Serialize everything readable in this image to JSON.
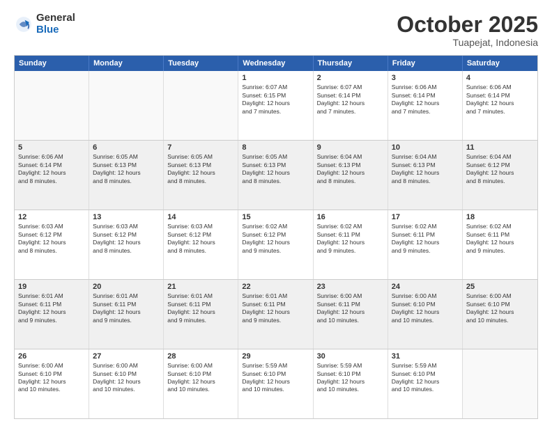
{
  "header": {
    "logo": {
      "general": "General",
      "blue": "Blue"
    },
    "title": "October 2025",
    "location": "Tuapejat, Indonesia"
  },
  "weekdays": [
    "Sunday",
    "Monday",
    "Tuesday",
    "Wednesday",
    "Thursday",
    "Friday",
    "Saturday"
  ],
  "rows": [
    [
      {
        "day": "",
        "text": "",
        "empty": true
      },
      {
        "day": "",
        "text": "",
        "empty": true
      },
      {
        "day": "",
        "text": "",
        "empty": true
      },
      {
        "day": "1",
        "text": "Sunrise: 6:07 AM\nSunset: 6:15 PM\nDaylight: 12 hours\nand 7 minutes."
      },
      {
        "day": "2",
        "text": "Sunrise: 6:07 AM\nSunset: 6:14 PM\nDaylight: 12 hours\nand 7 minutes."
      },
      {
        "day": "3",
        "text": "Sunrise: 6:06 AM\nSunset: 6:14 PM\nDaylight: 12 hours\nand 7 minutes."
      },
      {
        "day": "4",
        "text": "Sunrise: 6:06 AM\nSunset: 6:14 PM\nDaylight: 12 hours\nand 7 minutes."
      }
    ],
    [
      {
        "day": "5",
        "text": "Sunrise: 6:06 AM\nSunset: 6:14 PM\nDaylight: 12 hours\nand 8 minutes."
      },
      {
        "day": "6",
        "text": "Sunrise: 6:05 AM\nSunset: 6:13 PM\nDaylight: 12 hours\nand 8 minutes."
      },
      {
        "day": "7",
        "text": "Sunrise: 6:05 AM\nSunset: 6:13 PM\nDaylight: 12 hours\nand 8 minutes."
      },
      {
        "day": "8",
        "text": "Sunrise: 6:05 AM\nSunset: 6:13 PM\nDaylight: 12 hours\nand 8 minutes."
      },
      {
        "day": "9",
        "text": "Sunrise: 6:04 AM\nSunset: 6:13 PM\nDaylight: 12 hours\nand 8 minutes."
      },
      {
        "day": "10",
        "text": "Sunrise: 6:04 AM\nSunset: 6:13 PM\nDaylight: 12 hours\nand 8 minutes."
      },
      {
        "day": "11",
        "text": "Sunrise: 6:04 AM\nSunset: 6:12 PM\nDaylight: 12 hours\nand 8 minutes."
      }
    ],
    [
      {
        "day": "12",
        "text": "Sunrise: 6:03 AM\nSunset: 6:12 PM\nDaylight: 12 hours\nand 8 minutes."
      },
      {
        "day": "13",
        "text": "Sunrise: 6:03 AM\nSunset: 6:12 PM\nDaylight: 12 hours\nand 8 minutes."
      },
      {
        "day": "14",
        "text": "Sunrise: 6:03 AM\nSunset: 6:12 PM\nDaylight: 12 hours\nand 8 minutes."
      },
      {
        "day": "15",
        "text": "Sunrise: 6:02 AM\nSunset: 6:12 PM\nDaylight: 12 hours\nand 9 minutes."
      },
      {
        "day": "16",
        "text": "Sunrise: 6:02 AM\nSunset: 6:11 PM\nDaylight: 12 hours\nand 9 minutes."
      },
      {
        "day": "17",
        "text": "Sunrise: 6:02 AM\nSunset: 6:11 PM\nDaylight: 12 hours\nand 9 minutes."
      },
      {
        "day": "18",
        "text": "Sunrise: 6:02 AM\nSunset: 6:11 PM\nDaylight: 12 hours\nand 9 minutes."
      }
    ],
    [
      {
        "day": "19",
        "text": "Sunrise: 6:01 AM\nSunset: 6:11 PM\nDaylight: 12 hours\nand 9 minutes."
      },
      {
        "day": "20",
        "text": "Sunrise: 6:01 AM\nSunset: 6:11 PM\nDaylight: 12 hours\nand 9 minutes."
      },
      {
        "day": "21",
        "text": "Sunrise: 6:01 AM\nSunset: 6:11 PM\nDaylight: 12 hours\nand 9 minutes."
      },
      {
        "day": "22",
        "text": "Sunrise: 6:01 AM\nSunset: 6:11 PM\nDaylight: 12 hours\nand 9 minutes."
      },
      {
        "day": "23",
        "text": "Sunrise: 6:00 AM\nSunset: 6:11 PM\nDaylight: 12 hours\nand 10 minutes."
      },
      {
        "day": "24",
        "text": "Sunrise: 6:00 AM\nSunset: 6:10 PM\nDaylight: 12 hours\nand 10 minutes."
      },
      {
        "day": "25",
        "text": "Sunrise: 6:00 AM\nSunset: 6:10 PM\nDaylight: 12 hours\nand 10 minutes."
      }
    ],
    [
      {
        "day": "26",
        "text": "Sunrise: 6:00 AM\nSunset: 6:10 PM\nDaylight: 12 hours\nand 10 minutes."
      },
      {
        "day": "27",
        "text": "Sunrise: 6:00 AM\nSunset: 6:10 PM\nDaylight: 12 hours\nand 10 minutes."
      },
      {
        "day": "28",
        "text": "Sunrise: 6:00 AM\nSunset: 6:10 PM\nDaylight: 12 hours\nand 10 minutes."
      },
      {
        "day": "29",
        "text": "Sunrise: 5:59 AM\nSunset: 6:10 PM\nDaylight: 12 hours\nand 10 minutes."
      },
      {
        "day": "30",
        "text": "Sunrise: 5:59 AM\nSunset: 6:10 PM\nDaylight: 12 hours\nand 10 minutes."
      },
      {
        "day": "31",
        "text": "Sunrise: 5:59 AM\nSunset: 6:10 PM\nDaylight: 12 hours\nand 10 minutes."
      },
      {
        "day": "",
        "text": "",
        "empty": true
      }
    ]
  ]
}
